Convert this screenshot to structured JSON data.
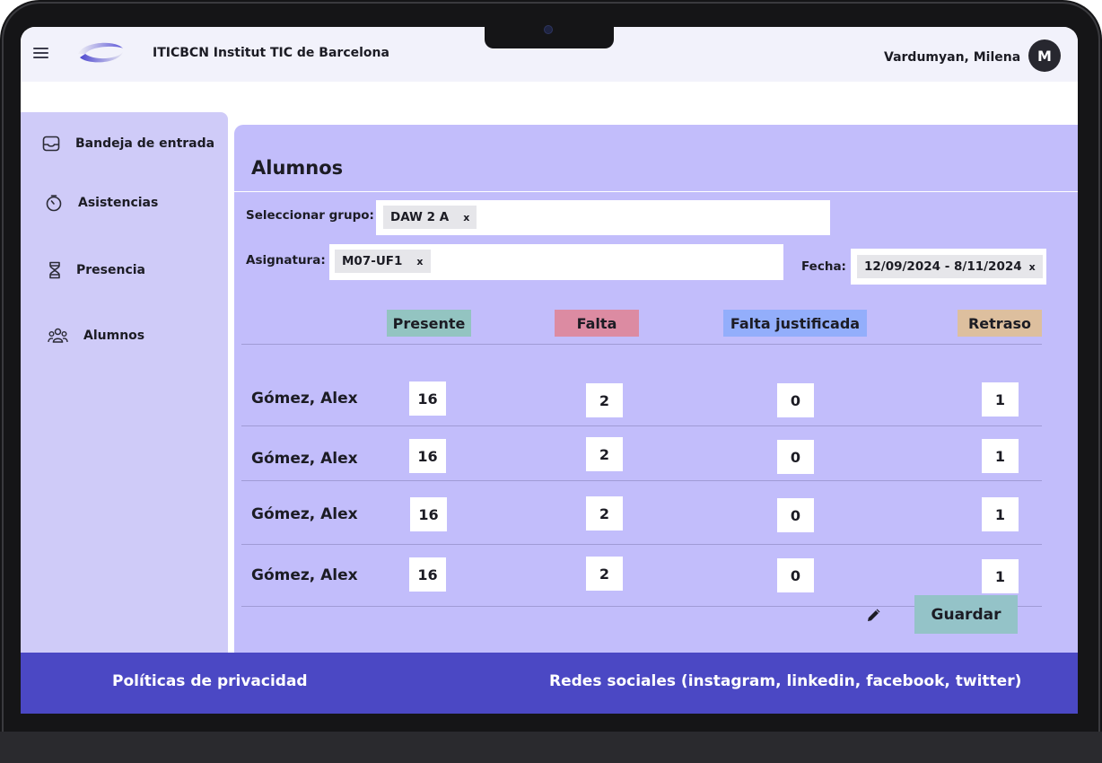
{
  "app": {
    "title": "ITICBCN Institut TIC de Barcelona"
  },
  "user": {
    "name": "Vardumyan, Milena",
    "initial": "M"
  },
  "sidebar": {
    "items": [
      {
        "label": "Bandeja de entrada",
        "icon": "inbox-icon"
      },
      {
        "label": "Asistencias",
        "icon": "timer-icon"
      },
      {
        "label": "Presencia",
        "icon": "hourglass-icon"
      },
      {
        "label": "Alumnos",
        "icon": "group-icon"
      }
    ]
  },
  "main": {
    "title": "Alumnos",
    "filters": {
      "group_label": "Seleccionar grupo:",
      "group_value": "DAW 2 A",
      "subject_label": "Asignatura:",
      "subject_value": "M07-UF1",
      "date_label": "Fecha:",
      "date_value": "12/09/2024 - 8/11/2024",
      "remove_glyph": "x"
    },
    "columns": [
      {
        "label": "Presente",
        "color": "#93c4c1"
      },
      {
        "label": "Falta",
        "color": "#dc8ba2"
      },
      {
        "label": "Falta justificada",
        "color": "#93aefb"
      },
      {
        "label": "Retraso",
        "color": "#ddbf9e"
      }
    ],
    "rows": [
      {
        "name": "Gómez, Alex",
        "presente": "16",
        "falta": "2",
        "justificada": "0",
        "retraso": "1"
      },
      {
        "name": "Gómez, Alex",
        "presente": "16",
        "falta": "2",
        "justificada": "0",
        "retraso": "1"
      },
      {
        "name": "Gómez, Alex",
        "presente": "16",
        "falta": "2",
        "justificada": "0",
        "retraso": "1"
      },
      {
        "name": "Gómez, Alex",
        "presente": "16",
        "falta": "2",
        "justificada": "0",
        "retraso": "1"
      }
    ],
    "save_label": "Guardar"
  },
  "footer": {
    "privacy": "Políticas de privacidad",
    "social": "Redes sociales (instagram, linkedin, facebook, twitter)"
  }
}
